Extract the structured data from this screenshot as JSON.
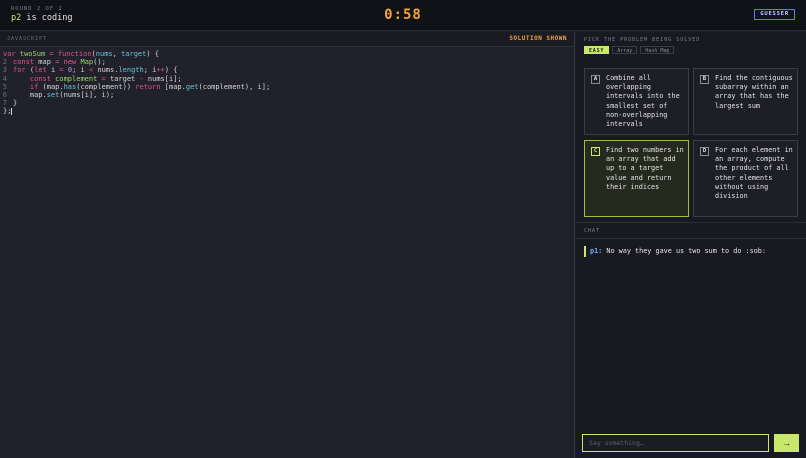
{
  "header": {
    "round": "ROUND 2 OF 2",
    "coder_name": "p2",
    "coder_status": "is coding",
    "timer": "0:58",
    "role": "GUESSER"
  },
  "editor": {
    "language": "JAVASCRIPT",
    "status": "SOLUTION SHOWN",
    "line_numbers": [
      "1",
      "2",
      "3",
      "4",
      "5",
      "6",
      "7",
      "8"
    ]
  },
  "picker": {
    "title": "PICK THE PROBLEM BEING SOLVED",
    "tags": [
      "EASY",
      "Array",
      "Hash Map"
    ],
    "problems": [
      {
        "letter": "A",
        "text": "Combine all overlapping intervals into the smallest set of non-overlapping intervals"
      },
      {
        "letter": "B",
        "text": "Find the contiguous subarray within an array that has the largest sum"
      },
      {
        "letter": "C",
        "text": "Find two numbers in an array that add up to a target value and return their indices"
      },
      {
        "letter": "D",
        "text": "For each element in an array, compute the product of all other elements without using division"
      }
    ]
  },
  "chat": {
    "title": "CHAT",
    "messages": [
      {
        "author": "p1:",
        "text": "No way they gave us two sum to do :sob:"
      }
    ],
    "placeholder": "Say something…",
    "send_label": "→"
  },
  "colors": {
    "accent": "#c9e86a",
    "timer": "#f2a33a",
    "role_border": "#5b7fd1"
  }
}
